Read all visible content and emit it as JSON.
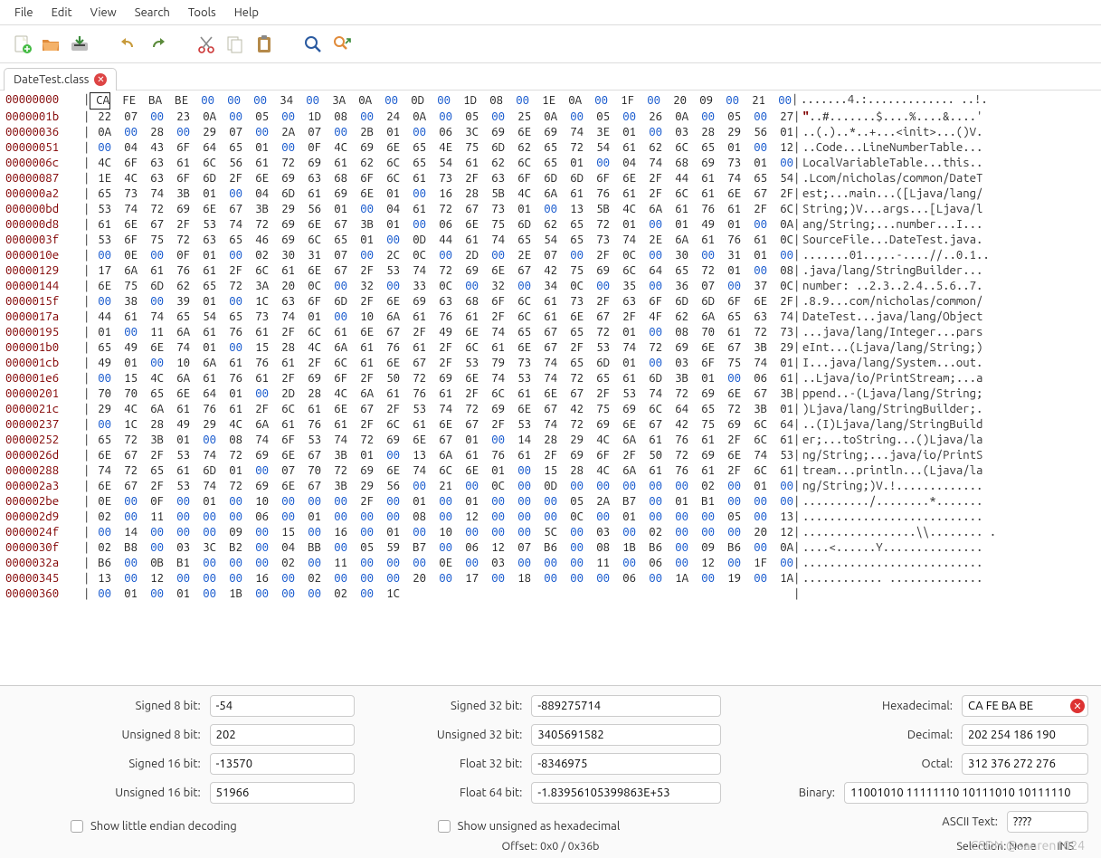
{
  "menu": [
    "File",
    "Edit",
    "View",
    "Search",
    "Tools",
    "Help"
  ],
  "toolbar_icons": [
    "new-doc-icon",
    "open-folder-icon",
    "save-icon",
    "undo-icon",
    "redo-icon",
    "cut-icon",
    "copy-icon",
    "paste-icon",
    "find-icon",
    "find-replace-icon"
  ],
  "tab": {
    "label": "DateTest.class",
    "icon": "close-icon"
  },
  "hex_rows": [
    {
      "offset": "00000000",
      "bytes": [
        "CA",
        "FE",
        "BA",
        "BE",
        "00",
        "00",
        "00",
        "34",
        "00",
        "3A",
        "0A",
        "00",
        "0D",
        "00",
        "1D",
        "08",
        "00",
        "1E",
        "0A",
        "00",
        "1F",
        "00",
        "20",
        "09",
        "00",
        "21",
        "00"
      ],
      "ascii": ".......4.:............. ..!."
    },
    {
      "offset": "0000001b",
      "bytes": [
        "22",
        "07",
        "00",
        "23",
        "0A",
        "00",
        "05",
        "00",
        "1D",
        "08",
        "00",
        "24",
        "0A",
        "00",
        "05",
        "00",
        "25",
        "0A",
        "00",
        "05",
        "00",
        "26",
        "0A",
        "00",
        "05",
        "00",
        "27"
      ],
      "ascii": "\"..#.......$....%....&....'"
    },
    {
      "offset": "00000036",
      "bytes": [
        "0A",
        "00",
        "28",
        "00",
        "29",
        "07",
        "00",
        "2A",
        "07",
        "00",
        "2B",
        "01",
        "00",
        "06",
        "3C",
        "69",
        "6E",
        "69",
        "74",
        "3E",
        "01",
        "00",
        "03",
        "28",
        "29",
        "56",
        "01"
      ],
      "ascii": "..(.)..*..+...<init>...()V."
    },
    {
      "offset": "00000051",
      "bytes": [
        "00",
        "04",
        "43",
        "6F",
        "64",
        "65",
        "01",
        "00",
        "0F",
        "4C",
        "69",
        "6E",
        "65",
        "4E",
        "75",
        "6D",
        "62",
        "65",
        "72",
        "54",
        "61",
        "62",
        "6C",
        "65",
        "01",
        "00",
        "12"
      ],
      "ascii": "..Code...LineNumberTable..."
    },
    {
      "offset": "0000006c",
      "bytes": [
        "4C",
        "6F",
        "63",
        "61",
        "6C",
        "56",
        "61",
        "72",
        "69",
        "61",
        "62",
        "6C",
        "65",
        "54",
        "61",
        "62",
        "6C",
        "65",
        "01",
        "00",
        "04",
        "74",
        "68",
        "69",
        "73",
        "01",
        "00"
      ],
      "ascii": "LocalVariableTable...this.."
    },
    {
      "offset": "00000087",
      "bytes": [
        "1E",
        "4C",
        "63",
        "6F",
        "6D",
        "2F",
        "6E",
        "69",
        "63",
        "68",
        "6F",
        "6C",
        "61",
        "73",
        "2F",
        "63",
        "6F",
        "6D",
        "6D",
        "6F",
        "6E",
        "2F",
        "44",
        "61",
        "74",
        "65",
        "54"
      ],
      "ascii": ".Lcom/nicholas/common/DateT"
    },
    {
      "offset": "000000a2",
      "bytes": [
        "65",
        "73",
        "74",
        "3B",
        "01",
        "00",
        "04",
        "6D",
        "61",
        "69",
        "6E",
        "01",
        "00",
        "16",
        "28",
        "5B",
        "4C",
        "6A",
        "61",
        "76",
        "61",
        "2F",
        "6C",
        "61",
        "6E",
        "67",
        "2F"
      ],
      "ascii": "est;...main...([Ljava/lang/"
    },
    {
      "offset": "000000bd",
      "bytes": [
        "53",
        "74",
        "72",
        "69",
        "6E",
        "67",
        "3B",
        "29",
        "56",
        "01",
        "00",
        "04",
        "61",
        "72",
        "67",
        "73",
        "01",
        "00",
        "13",
        "5B",
        "4C",
        "6A",
        "61",
        "76",
        "61",
        "2F",
        "6C"
      ],
      "ascii": "String;)V...args...[Ljava/l"
    },
    {
      "offset": "000000d8",
      "bytes": [
        "61",
        "6E",
        "67",
        "2F",
        "53",
        "74",
        "72",
        "69",
        "6E",
        "67",
        "3B",
        "01",
        "00",
        "06",
        "6E",
        "75",
        "6D",
        "62",
        "65",
        "72",
        "01",
        "00",
        "01",
        "49",
        "01",
        "00",
        "0A"
      ],
      "ascii": "ang/String;...number...I..."
    },
    {
      "offset": "0000003f",
      "bytes": [
        "53",
        "6F",
        "75",
        "72",
        "63",
        "65",
        "46",
        "69",
        "6C",
        "65",
        "01",
        "00",
        "0D",
        "44",
        "61",
        "74",
        "65",
        "54",
        "65",
        "73",
        "74",
        "2E",
        "6A",
        "61",
        "76",
        "61",
        "0C"
      ],
      "ascii": "SourceFile...DateTest.java."
    },
    {
      "offset": "0000010e",
      "bytes": [
        "00",
        "0E",
        "00",
        "0F",
        "01",
        "00",
        "02",
        "30",
        "31",
        "07",
        "00",
        "2C",
        "0C",
        "00",
        "2D",
        "00",
        "2E",
        "07",
        "00",
        "2F",
        "0C",
        "00",
        "30",
        "00",
        "31",
        "01",
        "00"
      ],
      "ascii": ".......01..,..-....//..0.1.."
    },
    {
      "offset": "00000129",
      "bytes": [
        "17",
        "6A",
        "61",
        "76",
        "61",
        "2F",
        "6C",
        "61",
        "6E",
        "67",
        "2F",
        "53",
        "74",
        "72",
        "69",
        "6E",
        "67",
        "42",
        "75",
        "69",
        "6C",
        "64",
        "65",
        "72",
        "01",
        "00",
        "08"
      ],
      "ascii": ".java/lang/StringBuilder..."
    },
    {
      "offset": "00000144",
      "bytes": [
        "6E",
        "75",
        "6D",
        "62",
        "65",
        "72",
        "3A",
        "20",
        "0C",
        "00",
        "32",
        "00",
        "33",
        "0C",
        "00",
        "32",
        "00",
        "34",
        "0C",
        "00",
        "35",
        "00",
        "36",
        "07",
        "00",
        "37",
        "0C"
      ],
      "ascii": "number: ..2.3..2.4..5.6..7."
    },
    {
      "offset": "0000015f",
      "bytes": [
        "00",
        "38",
        "00",
        "39",
        "01",
        "00",
        "1C",
        "63",
        "6F",
        "6D",
        "2F",
        "6E",
        "69",
        "63",
        "68",
        "6F",
        "6C",
        "61",
        "73",
        "2F",
        "63",
        "6F",
        "6D",
        "6D",
        "6F",
        "6E",
        "2F"
      ],
      "ascii": ".8.9...com/nicholas/common/"
    },
    {
      "offset": "0000017a",
      "bytes": [
        "44",
        "61",
        "74",
        "65",
        "54",
        "65",
        "73",
        "74",
        "01",
        "00",
        "10",
        "6A",
        "61",
        "76",
        "61",
        "2F",
        "6C",
        "61",
        "6E",
        "67",
        "2F",
        "4F",
        "62",
        "6A",
        "65",
        "63",
        "74"
      ],
      "ascii": "DateTest...java/lang/Object"
    },
    {
      "offset": "00000195",
      "bytes": [
        "01",
        "00",
        "11",
        "6A",
        "61",
        "76",
        "61",
        "2F",
        "6C",
        "61",
        "6E",
        "67",
        "2F",
        "49",
        "6E",
        "74",
        "65",
        "67",
        "65",
        "72",
        "01",
        "00",
        "08",
        "70",
        "61",
        "72",
        "73"
      ],
      "ascii": "...java/lang/Integer...pars"
    },
    {
      "offset": "000001b0",
      "bytes": [
        "65",
        "49",
        "6E",
        "74",
        "01",
        "00",
        "15",
        "28",
        "4C",
        "6A",
        "61",
        "76",
        "61",
        "2F",
        "6C",
        "61",
        "6E",
        "67",
        "2F",
        "53",
        "74",
        "72",
        "69",
        "6E",
        "67",
        "3B",
        "29"
      ],
      "ascii": "eInt...(Ljava/lang/String;)"
    },
    {
      "offset": "000001cb",
      "bytes": [
        "49",
        "01",
        "00",
        "10",
        "6A",
        "61",
        "76",
        "61",
        "2F",
        "6C",
        "61",
        "6E",
        "67",
        "2F",
        "53",
        "79",
        "73",
        "74",
        "65",
        "6D",
        "01",
        "00",
        "03",
        "6F",
        "75",
        "74",
        "01"
      ],
      "ascii": "I...java/lang/System...out."
    },
    {
      "offset": "000001e6",
      "bytes": [
        "00",
        "15",
        "4C",
        "6A",
        "61",
        "76",
        "61",
        "2F",
        "69",
        "6F",
        "2F",
        "50",
        "72",
        "69",
        "6E",
        "74",
        "53",
        "74",
        "72",
        "65",
        "61",
        "6D",
        "3B",
        "01",
        "00",
        "06",
        "61"
      ],
      "ascii": "..Ljava/io/PrintStream;...a"
    },
    {
      "offset": "00000201",
      "bytes": [
        "70",
        "70",
        "65",
        "6E",
        "64",
        "01",
        "00",
        "2D",
        "28",
        "4C",
        "6A",
        "61",
        "76",
        "61",
        "2F",
        "6C",
        "61",
        "6E",
        "67",
        "2F",
        "53",
        "74",
        "72",
        "69",
        "6E",
        "67",
        "3B"
      ],
      "ascii": "ppend..-(Ljava/lang/String;"
    },
    {
      "offset": "0000021c",
      "bytes": [
        "29",
        "4C",
        "6A",
        "61",
        "76",
        "61",
        "2F",
        "6C",
        "61",
        "6E",
        "67",
        "2F",
        "53",
        "74",
        "72",
        "69",
        "6E",
        "67",
        "42",
        "75",
        "69",
        "6C",
        "64",
        "65",
        "72",
        "3B",
        "01"
      ],
      "ascii": ")Ljava/lang/StringBuilder;."
    },
    {
      "offset": "00000237",
      "bytes": [
        "00",
        "1C",
        "28",
        "49",
        "29",
        "4C",
        "6A",
        "61",
        "76",
        "61",
        "2F",
        "6C",
        "61",
        "6E",
        "67",
        "2F",
        "53",
        "74",
        "72",
        "69",
        "6E",
        "67",
        "42",
        "75",
        "69",
        "6C",
        "64"
      ],
      "ascii": "..(I)Ljava/lang/StringBuild"
    },
    {
      "offset": "00000252",
      "bytes": [
        "65",
        "72",
        "3B",
        "01",
        "00",
        "08",
        "74",
        "6F",
        "53",
        "74",
        "72",
        "69",
        "6E",
        "67",
        "01",
        "00",
        "14",
        "28",
        "29",
        "4C",
        "6A",
        "61",
        "76",
        "61",
        "2F",
        "6C",
        "61"
      ],
      "ascii": "er;...toString...()Ljava/la"
    },
    {
      "offset": "0000026d",
      "bytes": [
        "6E",
        "67",
        "2F",
        "53",
        "74",
        "72",
        "69",
        "6E",
        "67",
        "3B",
        "01",
        "00",
        "13",
        "6A",
        "61",
        "76",
        "61",
        "2F",
        "69",
        "6F",
        "2F",
        "50",
        "72",
        "69",
        "6E",
        "74",
        "53"
      ],
      "ascii": "ng/String;...java/io/PrintS"
    },
    {
      "offset": "00000288",
      "bytes": [
        "74",
        "72",
        "65",
        "61",
        "6D",
        "01",
        "00",
        "07",
        "70",
        "72",
        "69",
        "6E",
        "74",
        "6C",
        "6E",
        "01",
        "00",
        "15",
        "28",
        "4C",
        "6A",
        "61",
        "76",
        "61",
        "2F",
        "6C",
        "61"
      ],
      "ascii": "tream...println...(Ljava/la"
    },
    {
      "offset": "000002a3",
      "bytes": [
        "6E",
        "67",
        "2F",
        "53",
        "74",
        "72",
        "69",
        "6E",
        "67",
        "3B",
        "29",
        "56",
        "00",
        "21",
        "00",
        "0C",
        "00",
        "0D",
        "00",
        "00",
        "00",
        "00",
        "00",
        "02",
        "00",
        "01",
        "00"
      ],
      "ascii": "ng/String;)V.!............."
    },
    {
      "offset": "000002be",
      "bytes": [
        "0E",
        "00",
        "0F",
        "00",
        "01",
        "00",
        "10",
        "00",
        "00",
        "00",
        "2F",
        "00",
        "01",
        "00",
        "01",
        "00",
        "00",
        "00",
        "05",
        "2A",
        "B7",
        "00",
        "01",
        "B1",
        "00",
        "00",
        "00"
      ],
      "ascii": "........../........*......."
    },
    {
      "offset": "000002d9",
      "bytes": [
        "02",
        "00",
        "11",
        "00",
        "00",
        "00",
        "06",
        "00",
        "01",
        "00",
        "00",
        "00",
        "08",
        "00",
        "12",
        "00",
        "00",
        "00",
        "0C",
        "00",
        "01",
        "00",
        "00",
        "00",
        "05",
        "00",
        "13"
      ],
      "ascii": "..........................."
    },
    {
      "offset": "0000024f",
      "bytes": [
        "00",
        "14",
        "00",
        "00",
        "00",
        "09",
        "00",
        "15",
        "00",
        "16",
        "00",
        "01",
        "00",
        "10",
        "00",
        "00",
        "00",
        "5C",
        "00",
        "03",
        "00",
        "02",
        "00",
        "00",
        "00",
        "20",
        "12"
      ],
      "ascii": ".................\\\\........ ."
    },
    {
      "offset": "0000030f",
      "bytes": [
        "02",
        "B8",
        "00",
        "03",
        "3C",
        "B2",
        "00",
        "04",
        "BB",
        "00",
        "05",
        "59",
        "B7",
        "00",
        "06",
        "12",
        "07",
        "B6",
        "00",
        "08",
        "1B",
        "B6",
        "00",
        "09",
        "B6",
        "00",
        "0A"
      ],
      "ascii": "....<......Y..............."
    },
    {
      "offset": "0000032a",
      "bytes": [
        "B6",
        "00",
        "0B",
        "B1",
        "00",
        "00",
        "00",
        "02",
        "00",
        "11",
        "00",
        "00",
        "00",
        "0E",
        "00",
        "03",
        "00",
        "00",
        "00",
        "11",
        "00",
        "06",
        "00",
        "12",
        "00",
        "1F",
        "00"
      ],
      "ascii": "..........................."
    },
    {
      "offset": "00000345",
      "bytes": [
        "13",
        "00",
        "12",
        "00",
        "00",
        "00",
        "16",
        "00",
        "02",
        "00",
        "00",
        "00",
        "20",
        "00",
        "17",
        "00",
        "18",
        "00",
        "00",
        "00",
        "06",
        "00",
        "1A",
        "00",
        "19",
        "00",
        "1A"
      ],
      "ascii": "............ .............."
    },
    {
      "offset": "00000360",
      "bytes": [
        "00",
        "01",
        "00",
        "01",
        "00",
        "1B",
        "00",
        "00",
        "00",
        "02",
        "00",
        "1C"
      ],
      "ascii": ""
    }
  ],
  "inspector": {
    "signed8_label": "Signed 8 bit:",
    "signed8_val": "-54",
    "unsigned8_label": "Unsigned 8 bit:",
    "unsigned8_val": "202",
    "signed16_label": "Signed 16 bit:",
    "signed16_val": "-13570",
    "unsigned16_label": "Unsigned 16 bit:",
    "unsigned16_val": "51966",
    "signed32_label": "Signed 32 bit:",
    "signed32_val": "-889275714",
    "unsigned32_label": "Unsigned 32 bit:",
    "unsigned32_val": "3405691582",
    "float32_label": "Float 32 bit:",
    "float32_val": "-8346975",
    "float64_label": "Float 64 bit:",
    "float64_val": "-1.83956105399863E+53",
    "hex_label": "Hexadecimal:",
    "hex_val": "CA FE BA BE",
    "dec_label": "Decimal:",
    "dec_val": "202 254 186 190",
    "oct_label": "Octal:",
    "oct_val": "312 376 272 276",
    "bin_label": "Binary:",
    "bin_val": "11001010 11111110 10111010 10111110",
    "ascii_label": "ASCII Text:",
    "ascii_val": "????",
    "cb_le": "Show little endian decoding",
    "cb_uh": "Show unsigned as hexadecimal"
  },
  "statusbar": {
    "offset": "Offset: 0x0 / 0x36b",
    "selection": "Selection: None",
    "ins": "INS"
  },
  "watermark": "CSDN @sanren1024"
}
